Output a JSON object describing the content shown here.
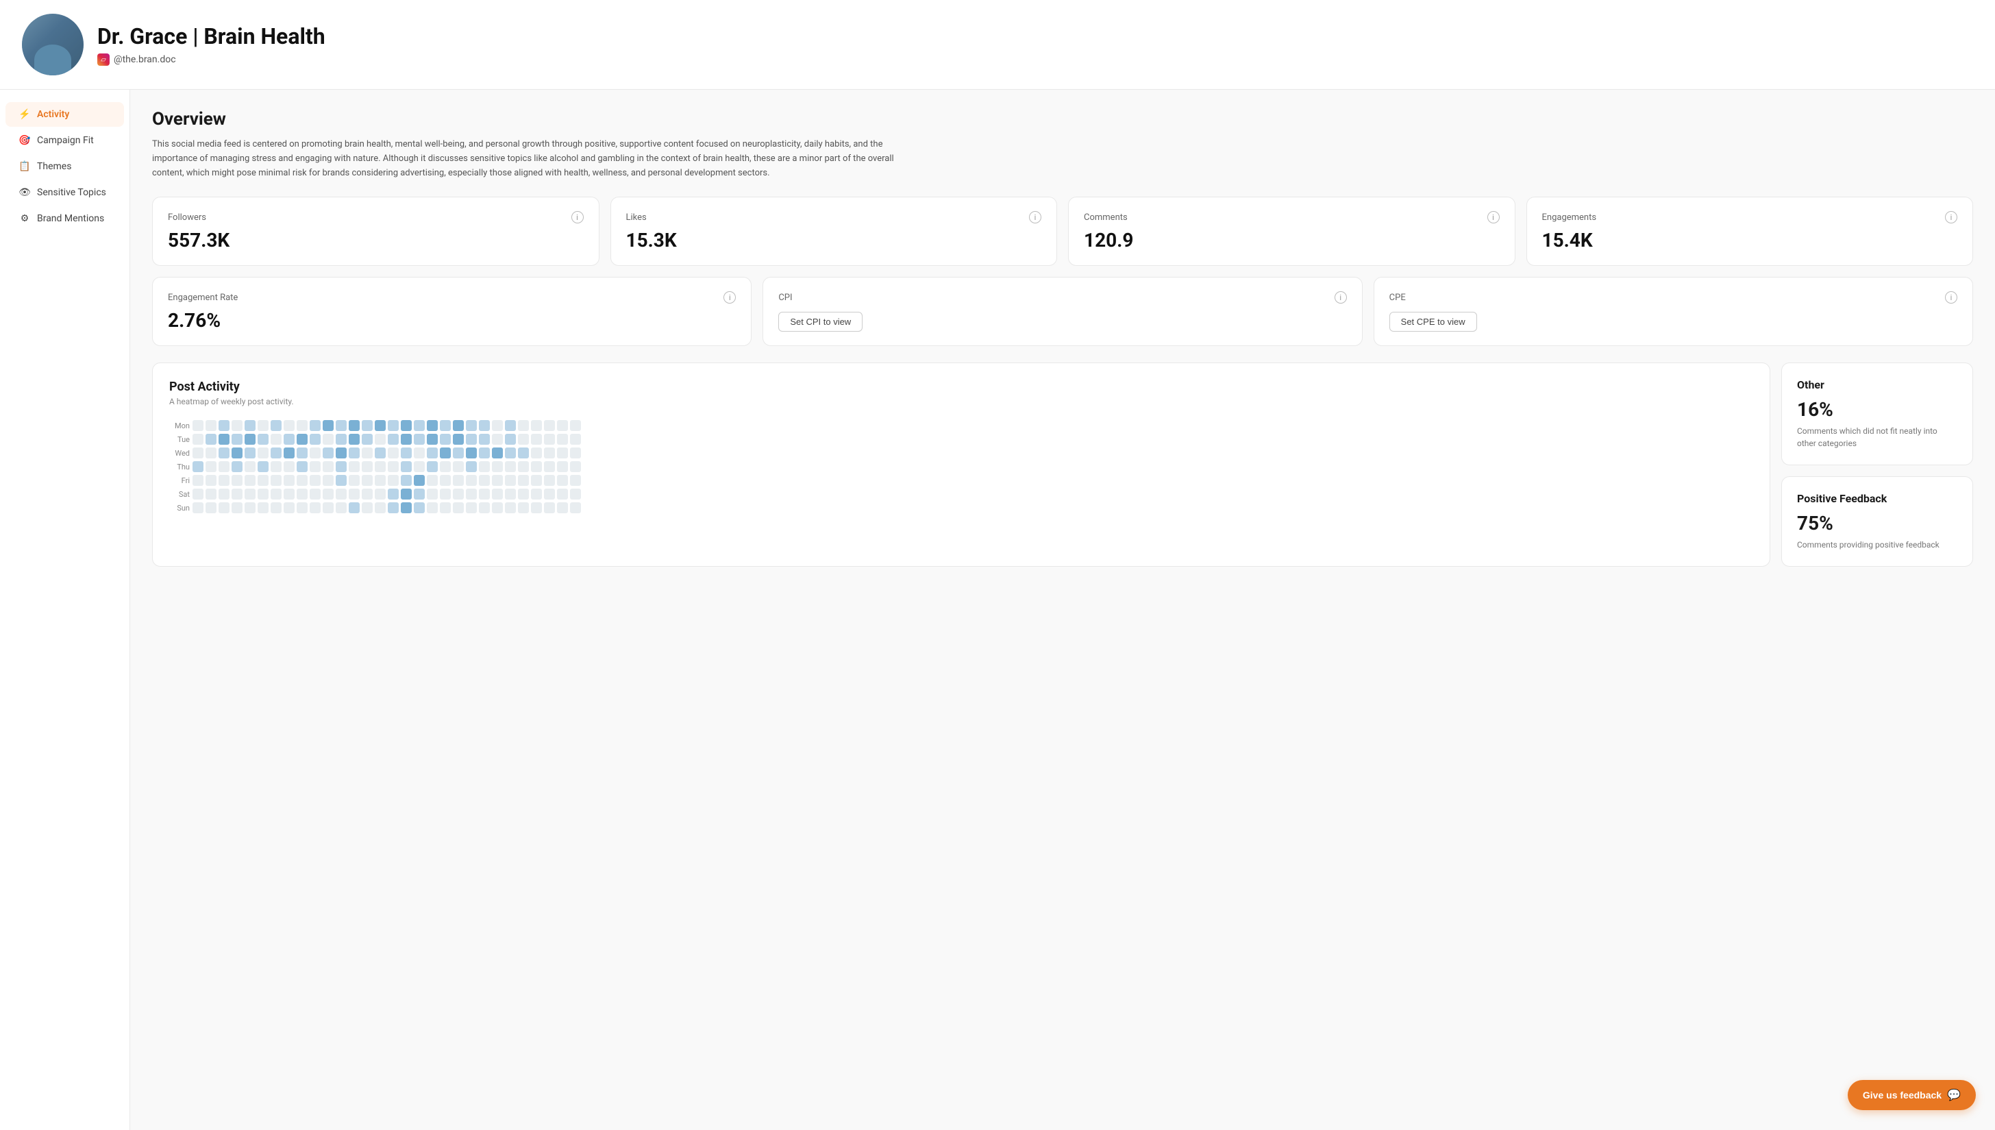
{
  "header": {
    "title": "Dr. Grace | Brain Health",
    "instagram_handle": "@the.bran.doc",
    "instagram_url": "#"
  },
  "sidebar": {
    "items": [
      {
        "id": "activity",
        "label": "Activity",
        "icon": "⚡",
        "active": true
      },
      {
        "id": "campaign-fit",
        "label": "Campaign Fit",
        "icon": "🎯",
        "active": false
      },
      {
        "id": "themes",
        "label": "Themes",
        "icon": "📋",
        "active": false
      },
      {
        "id": "sensitive-topics",
        "label": "Sensitive Topics",
        "icon": "👁",
        "active": false
      },
      {
        "id": "brand-mentions",
        "label": "Brand Mentions",
        "icon": "⚙",
        "active": false
      }
    ]
  },
  "overview": {
    "title": "Overview",
    "description": "This social media feed is centered on promoting brain health, mental well-being, and personal growth through positive, supportive content focused on neuroplasticity, daily habits, and the importance of managing stress and engaging with nature. Although it discusses sensitive topics like alcohol and gambling in the context of brain health, these are a minor part of the overall content, which might pose minimal risk for brands considering advertising, especially those aligned with health, wellness, and personal development sectors."
  },
  "stats": {
    "followers": {
      "label": "Followers",
      "value": "557.3K"
    },
    "likes": {
      "label": "Likes",
      "value": "15.3K"
    },
    "comments": {
      "label": "Comments",
      "value": "120.9"
    },
    "engagements": {
      "label": "Engagements",
      "value": "15.4K"
    },
    "engagement_rate": {
      "label": "Engagement Rate",
      "value": "2.76%"
    },
    "cpi": {
      "label": "CPI",
      "value": null,
      "btn_label": "Set CPI to view"
    },
    "cpe": {
      "label": "CPE",
      "value": null,
      "btn_label": "Set CPE to view"
    }
  },
  "post_activity": {
    "title": "Post Activity",
    "description": "A heatmap of weekly post activity.",
    "days": [
      "Mon",
      "Tue",
      "Wed",
      "Thu",
      "Fri",
      "Sat",
      "Sun"
    ],
    "heatmap_data": {
      "Mon": [
        0,
        0,
        1,
        0,
        1,
        0,
        1,
        0,
        0,
        1,
        2,
        1,
        2,
        1,
        2,
        1,
        2,
        1,
        2,
        1,
        2,
        1,
        1,
        0,
        1,
        0,
        0,
        0,
        0,
        0
      ],
      "Tue": [
        0,
        1,
        2,
        1,
        2,
        1,
        0,
        1,
        2,
        1,
        0,
        1,
        2,
        1,
        0,
        1,
        2,
        1,
        2,
        1,
        2,
        1,
        1,
        0,
        1,
        0,
        0,
        0,
        0,
        0
      ],
      "Wed": [
        0,
        0,
        1,
        2,
        1,
        0,
        1,
        2,
        1,
        0,
        1,
        2,
        1,
        0,
        1,
        0,
        1,
        0,
        1,
        2,
        1,
        2,
        1,
        2,
        1,
        1,
        0,
        0,
        0,
        0
      ],
      "Thu": [
        1,
        0,
        0,
        1,
        0,
        1,
        0,
        0,
        1,
        0,
        0,
        1,
        0,
        0,
        0,
        0,
        1,
        0,
        1,
        0,
        0,
        1,
        0,
        0,
        0,
        0,
        0,
        0,
        0,
        0
      ],
      "Fri": [
        0,
        0,
        0,
        0,
        0,
        0,
        0,
        0,
        0,
        0,
        0,
        1,
        0,
        0,
        0,
        0,
        1,
        2,
        0,
        0,
        0,
        0,
        0,
        0,
        0,
        0,
        0,
        0,
        0,
        0
      ],
      "Sat": [
        0,
        0,
        0,
        0,
        0,
        0,
        0,
        0,
        0,
        0,
        0,
        0,
        0,
        0,
        0,
        1,
        2,
        1,
        0,
        0,
        0,
        0,
        0,
        0,
        0,
        0,
        0,
        0,
        0,
        0
      ],
      "Sun": [
        0,
        0,
        0,
        0,
        0,
        0,
        0,
        0,
        0,
        0,
        0,
        0,
        1,
        0,
        0,
        1,
        2,
        1,
        0,
        0,
        0,
        0,
        0,
        0,
        0,
        0,
        0,
        0,
        0,
        0
      ]
    }
  },
  "right_panel": {
    "other": {
      "title": "Other",
      "percentage": "16%",
      "description": "Comments which did not fit neatly into other categories"
    },
    "positive_feedback": {
      "title": "Positive Feedback",
      "percentage": "75%",
      "description": "Comments providing positive feedback"
    }
  },
  "feedback_button": {
    "label": "Give us feedback"
  }
}
